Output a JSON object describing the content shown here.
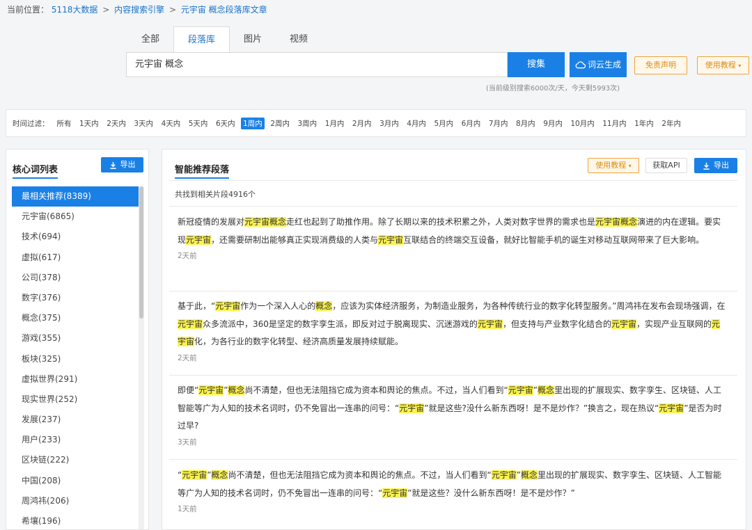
{
  "breadcrumb": {
    "prefix": "当前位置：",
    "items": [
      "5118大数据",
      "内容搜索引擎",
      "元宇宙 概念段落库文章"
    ],
    "separator": ">"
  },
  "tabs": [
    {
      "label": "全部",
      "active": false
    },
    {
      "label": "段落库",
      "active": true
    },
    {
      "label": "图片",
      "active": false
    },
    {
      "label": "视频",
      "active": false
    }
  ],
  "search": {
    "value": "元宇宙 概念",
    "button_label": "搜集",
    "cloud_label": "词云生成",
    "cloud_icon": "cloud-icon",
    "disclaimer_label": "免责声明",
    "tutorial_label": "使用教程",
    "quota_text": "(当前级别搜索6000次/天，今天剩5993次)"
  },
  "time_filter": {
    "label": "时间过滤：",
    "items": [
      "所有",
      "1天内",
      "2天内",
      "3天内",
      "4天内",
      "5天内",
      "6天内",
      "1周内",
      "2周内",
      "3周内",
      "1月内",
      "2月内",
      "3月内",
      "4月内",
      "5月内",
      "6月内",
      "7月内",
      "8月内",
      "9月内",
      "10月内",
      "11月内",
      "1年内",
      "2年内"
    ],
    "active": "1周内"
  },
  "left_panel": {
    "title": "核心词列表",
    "export_label": "导出",
    "export_icon": "download-icon",
    "items": [
      {
        "label": "最相关推荐(8389)",
        "active": true
      },
      {
        "label": "元宇宙(6865)"
      },
      {
        "label": "技术(694)"
      },
      {
        "label": "虚拟(617)"
      },
      {
        "label": "公司(378)"
      },
      {
        "label": "数字(376)"
      },
      {
        "label": "概念(375)"
      },
      {
        "label": "游戏(355)"
      },
      {
        "label": "板块(325)"
      },
      {
        "label": "虚拟世界(291)"
      },
      {
        "label": "现实世界(252)"
      },
      {
        "label": "发展(237)"
      },
      {
        "label": "用户(233)"
      },
      {
        "label": "区块链(222)"
      },
      {
        "label": "中国(208)"
      },
      {
        "label": "周鸿祎(206)"
      },
      {
        "label": "希壤(196)"
      }
    ]
  },
  "right_panel": {
    "title": "智能推荐段落",
    "tutorial_label": "使用教程",
    "api_label": "获取API",
    "export_label": "导出",
    "count_text": "共找到相关片段4916个",
    "highlight_color": "#fbf34e",
    "results": [
      {
        "segments": [
          {
            "t": "新冠疫情的发展对"
          },
          {
            "t": "元宇宙概念",
            "h": true
          },
          {
            "t": "走红也起到了助推作用。除了长期以来的技术积累之外，人类对数字世界的需求也是"
          },
          {
            "t": "元宇宙概念",
            "h": true
          },
          {
            "t": "演进的内在逻辑。要实现"
          },
          {
            "t": "元宇宙",
            "h": true
          },
          {
            "t": "，还需要研制出能够真正实现消费级的人类与"
          },
          {
            "t": "元宇宙",
            "h": true
          },
          {
            "t": "互联结合的终端交互设备，就好比智能手机的诞生对移动互联网带来了巨大影响。"
          }
        ],
        "time": "2天前"
      },
      {
        "segments": [
          {
            "t": "基于此，“"
          },
          {
            "t": "元宇宙",
            "h": true
          },
          {
            "t": "作为一个深入人心的"
          },
          {
            "t": "概念",
            "h": true
          },
          {
            "t": "，应该为实体经济服务，为制造业服务，为各种传统行业的数字化转型服务。”周鸿祎在发布会现场强调，在"
          },
          {
            "t": "元宇宙",
            "h": true
          },
          {
            "t": "众多流派中，360是坚定的数字孪生派，即反对过于脱离现实、沉迷游戏的"
          },
          {
            "t": "元宇宙",
            "h": true
          },
          {
            "t": "，但支持与产业数字化结合的"
          },
          {
            "t": "元宇宙",
            "h": true
          },
          {
            "t": "，实现产业互联网的"
          },
          {
            "t": "元宇宙",
            "h": true
          },
          {
            "t": "化，为各行业的数字化转型、经济高质量发展持续赋能。"
          }
        ],
        "time": "2天前"
      },
      {
        "segments": [
          {
            "t": "即便“"
          },
          {
            "t": "元宇宙",
            "h": true
          },
          {
            "t": "”"
          },
          {
            "t": "概念",
            "h": true
          },
          {
            "t": "尚不清楚，但也无法阻挡它成为资本和舆论的焦点。不过，当人们看到“"
          },
          {
            "t": "元宇宙",
            "h": true
          },
          {
            "t": "”"
          },
          {
            "t": "概念",
            "h": true
          },
          {
            "t": "里出现的扩展现实、数字孪生、区块链、人工智能等广为人知的技术名词时，仍不免冒出一连串的问号：“"
          },
          {
            "t": "元宇宙",
            "h": true
          },
          {
            "t": "”就是这些?没什么新东西呀！是不是炒作？”换言之，现在热议“"
          },
          {
            "t": "元宇宙",
            "h": true
          },
          {
            "t": "”是否为时过早?"
          }
        ],
        "time": "3天前"
      },
      {
        "segments": [
          {
            "t": "“"
          },
          {
            "t": "元宇宙",
            "h": true
          },
          {
            "t": "”"
          },
          {
            "t": "概念",
            "h": true
          },
          {
            "t": "尚不清楚，但也无法阻挡它成为资本和舆论的焦点。不过，当人们看到“"
          },
          {
            "t": "元宇宙",
            "h": true
          },
          {
            "t": "”"
          },
          {
            "t": "概念",
            "h": true
          },
          {
            "t": "里出现的扩展现实、数字孪生、区块链、人工智能等广为人知的技术名词时，仍不免冒出一连串的问号：“"
          },
          {
            "t": "元宇宙",
            "h": true
          },
          {
            "t": "”就是这些？没什么新东西呀！是不是炒作？”"
          }
        ],
        "time": "1天前"
      }
    ]
  }
}
